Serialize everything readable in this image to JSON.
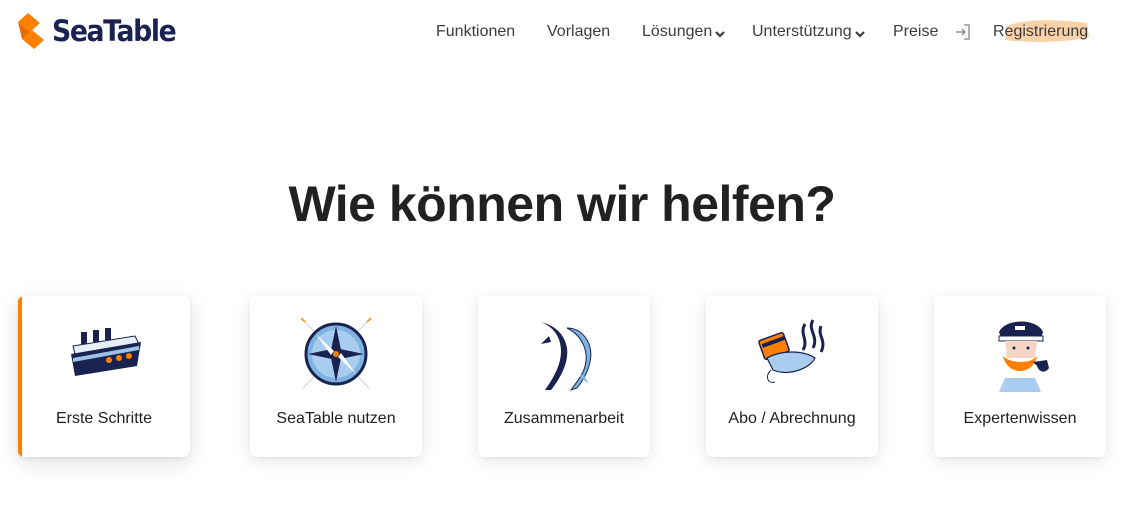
{
  "brand": {
    "name": "SeaTable",
    "accent": "#ff8000",
    "navy": "#1a2350"
  },
  "nav": {
    "items": [
      {
        "label": "Funktionen",
        "dropdown": false
      },
      {
        "label": "Vorlagen",
        "dropdown": false
      },
      {
        "label": "Lösungen",
        "dropdown": true
      },
      {
        "label": "Unterstützung",
        "dropdown": true
      },
      {
        "label": "Preise",
        "dropdown": false
      }
    ],
    "login_icon": "login-icon",
    "register_label": "Registrierung",
    "register_highlight_color": "#f9c99a"
  },
  "hero": {
    "title": "Wie können wir helfen?"
  },
  "cards": [
    {
      "label": "Erste Schritte",
      "icon": "ship-icon",
      "active": true
    },
    {
      "label": "SeaTable nutzen",
      "icon": "compass-icon",
      "active": false
    },
    {
      "label": "Zusammenarbeit",
      "icon": "dolphins-icon",
      "active": false
    },
    {
      "label": "Abo / Abrechnung",
      "icon": "credit-card-shell-icon",
      "active": false
    },
    {
      "label": "Expertenwissen",
      "icon": "sea-captain-icon",
      "active": false
    }
  ]
}
